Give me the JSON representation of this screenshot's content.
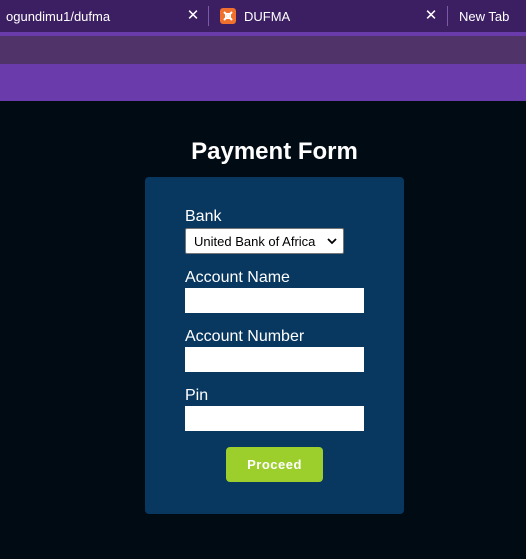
{
  "browser": {
    "tabs": [
      {
        "label": "ogundimu1/dufma",
        "close": "✕"
      },
      {
        "label": "DUFMA",
        "close": "✕",
        "icon": "xampp-icon"
      },
      {
        "label": "New Tab"
      }
    ]
  },
  "form": {
    "title": "Payment Form",
    "bank_label": "Bank",
    "bank_selected": "United Bank of Africa",
    "account_name_label": "Account Name",
    "account_name_value": "",
    "account_number_label": "Account Number",
    "account_number_value": "",
    "pin_label": "Pin",
    "pin_value": "",
    "proceed_label": "Proceed"
  },
  "colors": {
    "page_bg": "#000b14",
    "card_bg": "#083860",
    "tabbar_bg": "#3c1f63",
    "purple_band": "#6a3cab",
    "button_bg": "#9ccf2c"
  }
}
